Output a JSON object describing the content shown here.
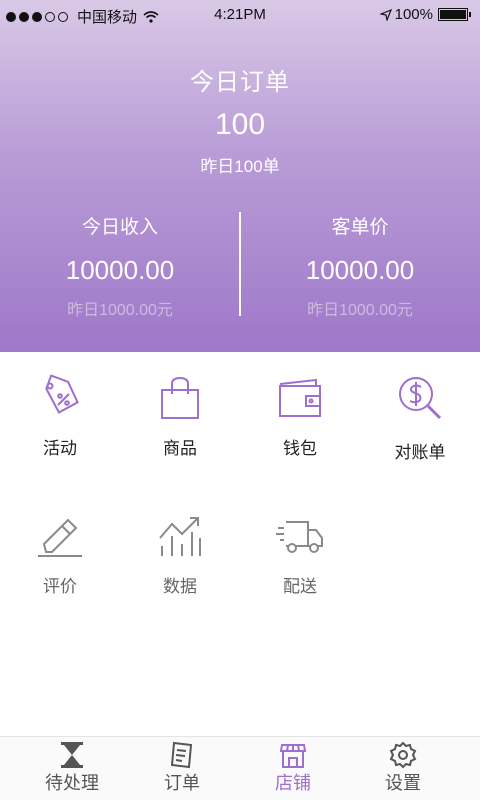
{
  "status_bar": {
    "carrier": "中国移动",
    "time": "4:21PM",
    "battery": "100%"
  },
  "summary": {
    "title": "今日订单",
    "count": "100",
    "yesterday": "昨日100单"
  },
  "income": {
    "label": "今日收入",
    "value": "10000.00",
    "yesterday": "昨日1000.00元"
  },
  "avg_price": {
    "label": "客单价",
    "value": "10000.00",
    "yesterday": "昨日1000.00元"
  },
  "grid": {
    "activity": "活动",
    "goods": "商品",
    "wallet": "钱包",
    "reconcile": "对账单",
    "review": "评价",
    "data": "数据",
    "delivery": "配送"
  },
  "tabs": {
    "pending": "待处理",
    "orders": "订单",
    "store": "店铺",
    "settings": "设置"
  },
  "colors": {
    "accent": "#9d6fcf",
    "header_top": "#d9c9e7",
    "header_bottom": "#9f78c9"
  }
}
